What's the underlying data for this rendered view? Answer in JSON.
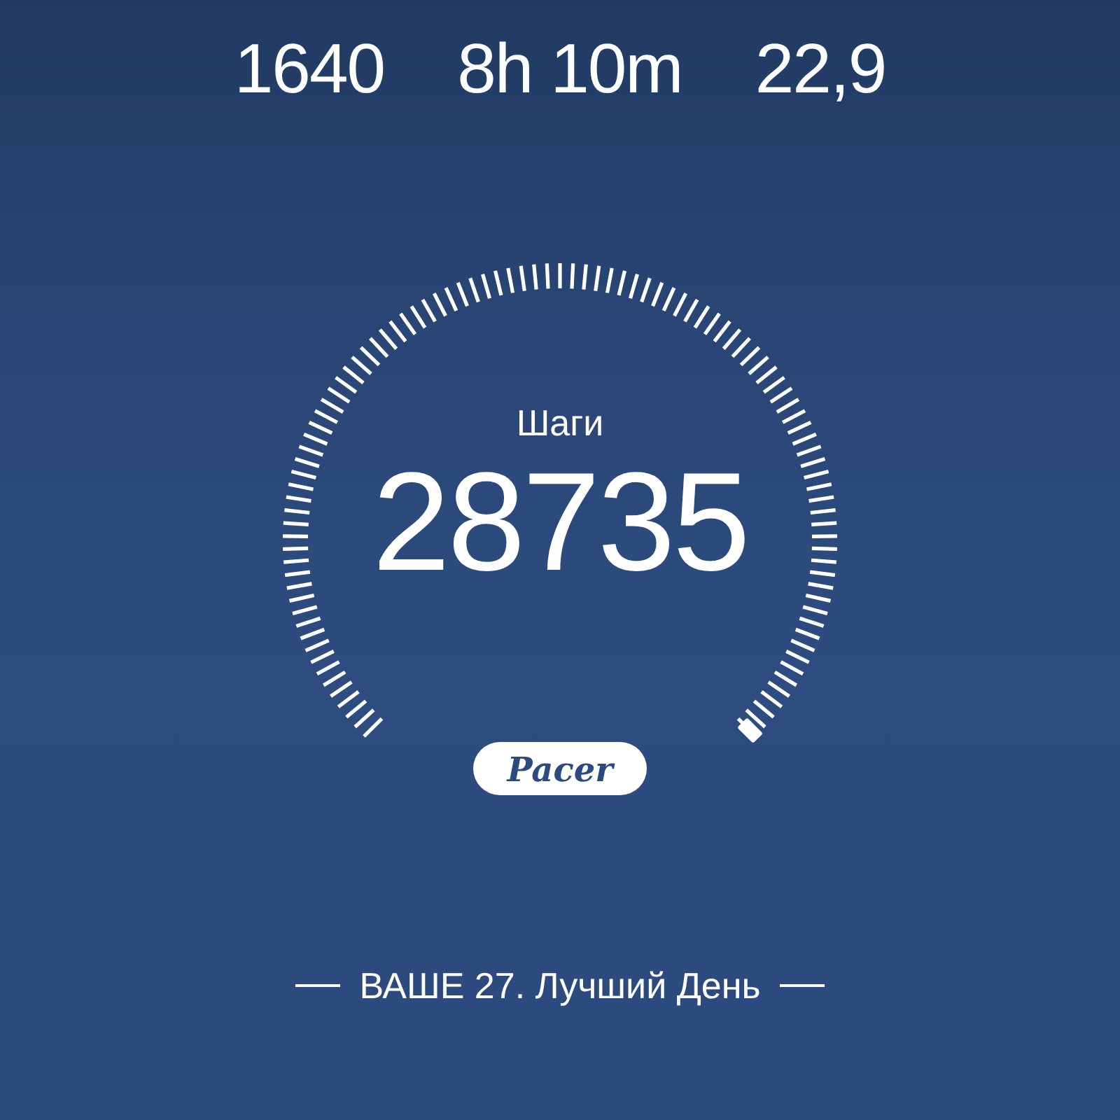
{
  "stats": [
    {
      "value": "1640"
    },
    {
      "value": "8h 10m"
    },
    {
      "value": "22,9"
    }
  ],
  "gauge": {
    "label": "Шаги",
    "value": "28735",
    "brand": "Pacer"
  },
  "best_day": {
    "text": "ВАШЕ 27. Лучший День"
  }
}
